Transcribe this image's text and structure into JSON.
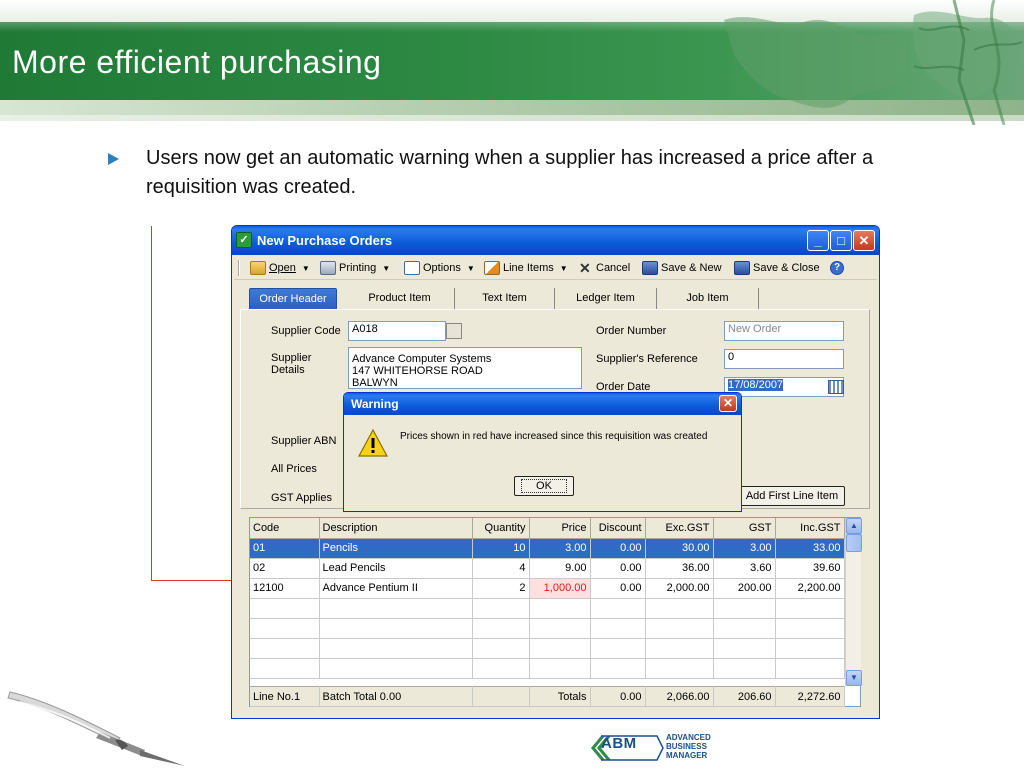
{
  "slide": {
    "title": "More efficient purchasing",
    "bullet": "Users now get an automatic warning when a supplier has increased a price after a requisition was created."
  },
  "window": {
    "title": "New Purchase Orders",
    "toolbar": {
      "open": "Open",
      "printing": "Printing",
      "options": "Options",
      "line_items": "Line Items",
      "cancel": "Cancel",
      "save_new": "Save & New",
      "save_close": "Save & Close"
    },
    "tabs": [
      "Order Header",
      "Product Item",
      "Text Item",
      "Ledger Item",
      "Job Item"
    ],
    "active_tab": "Order Header",
    "form": {
      "supplier_code_label": "Supplier Code",
      "supplier_code": "A018",
      "supplier_details_label": "Supplier\nDetails",
      "supplier_details": "Advance Computer Systems\n147 WHITEHORSE ROAD\nBALWYN",
      "supplier_abn_label": "Supplier ABN",
      "all_prices_label": "All Prices",
      "gst_applies_label": "GST Applies",
      "order_number_label": "Order Number",
      "order_number": "New Order",
      "supplier_reference_label": "Supplier's Reference",
      "supplier_reference": "0",
      "order_date_label": "Order Date",
      "order_date": "17/08/2007",
      "add_first_line_button": "Add First Line Item"
    },
    "grid": {
      "columns": [
        "Code",
        "Description",
        "Quantity",
        "Price",
        "Discount",
        "Exc.GST",
        "GST",
        "Inc.GST"
      ],
      "rows": [
        [
          "01",
          "Pencils",
          "10",
          "3.00",
          "0.00",
          "30.00",
          "3.00",
          "33.00"
        ],
        [
          "02",
          "Lead Pencils",
          "4",
          "9.00",
          "0.00",
          "36.00",
          "3.60",
          "39.60"
        ],
        [
          "12100",
          "Advance Pentium II",
          "2",
          "1,000.00",
          "0.00",
          "2,000.00",
          "200.00",
          "2,200.00"
        ]
      ],
      "selected_row": 0,
      "price_increased_row": 2,
      "footer": [
        "Line No.1",
        "Batch Total 0.00",
        "",
        "Totals",
        "0.00",
        "2,066.00",
        "206.60",
        "2,272.60"
      ]
    }
  },
  "dialog": {
    "title": "Warning",
    "message": "Prices shown in red have increased since this requisition was created",
    "ok_button": "OK"
  },
  "branding": {
    "logo_mark": "ABM",
    "logo_text": [
      "ADVANCED",
      "BUSINESS",
      "MANAGER"
    ]
  },
  "colors": {
    "header_green": "#2d8a43",
    "accent_blue": "#2f7fbf",
    "xp_title_blue": "#0b5bd9",
    "selected_row": "#316ac5",
    "price_increase_red": "#e01b1b"
  }
}
